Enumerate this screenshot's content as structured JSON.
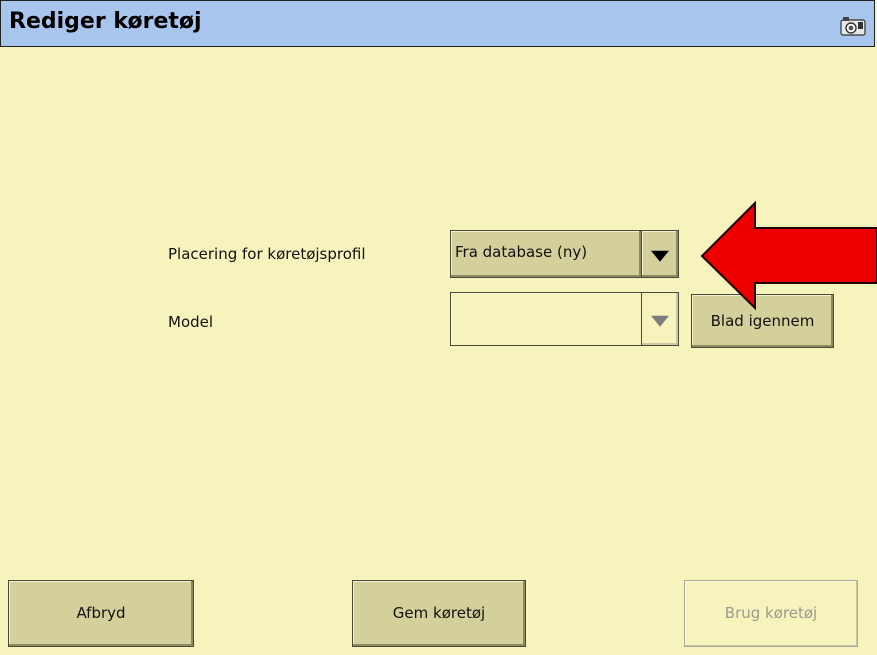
{
  "window": {
    "title": "Rediger køretøj",
    "icon": "camera-icon"
  },
  "form": {
    "location_label": "Placering for køretøjsprofil",
    "location_value": "Fra database (ny)",
    "model_label": "Model",
    "model_value": "",
    "browse_label": "Blad igennem"
  },
  "footer": {
    "cancel_label": "Afbryd",
    "save_label": "Gem køretøj",
    "use_label": "Brug køretøj"
  },
  "colors": {
    "background": "#f6f3bd",
    "titlebar": "#a8c5ee",
    "button": "#d4d09c",
    "annotation_arrow": "#ee0000"
  }
}
